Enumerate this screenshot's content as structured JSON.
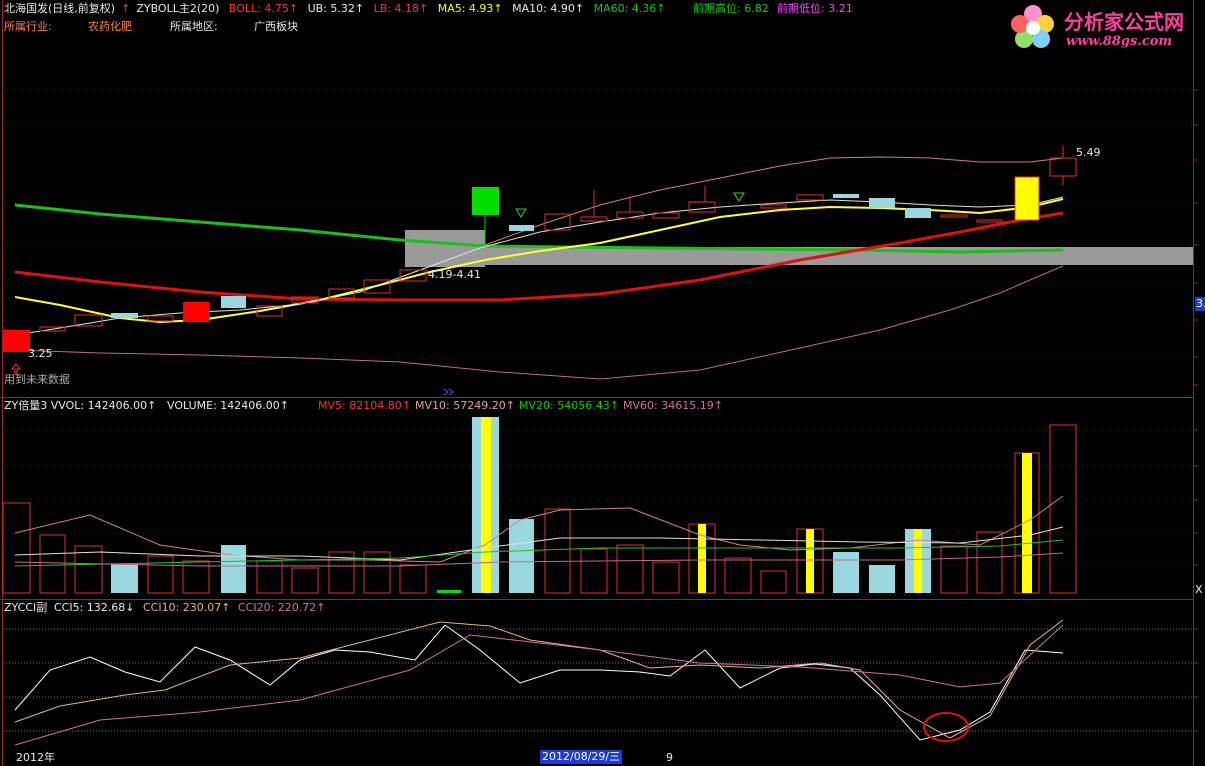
{
  "main_header": {
    "stock": "北海国发(日线,前复权)",
    "arrow": "↑",
    "indicator": "ZYBOLL主2(20)",
    "boll": "BOLL: 4.75↑",
    "ub": "UB: 5.32↑",
    "lb": "LB: 4.18↑",
    "ma5": "MA5: 4.93↑",
    "ma10": "MA10: 4.90↑",
    "ma60": "MA60: 4.36↑",
    "prev_high": "前期高位: 6.82",
    "prev_low": "前期低位: 3.21"
  },
  "info_row": {
    "industry_label": "所属行业:",
    "industry_value": "农药化肥",
    "region_label": "所属地区:",
    "region_value": "广西板块"
  },
  "main_annotations": {
    "high_label": "5.49",
    "low_label": "3.25",
    "range_label": "4.19-4.41",
    "future_note": "用到未来数据",
    "axis_marker": "3."
  },
  "volume_header": {
    "title": "ZY倍量3",
    "vvol": "VVOL: 142406.00↑",
    "volume": "VOLUME: 142406.00↑",
    "mv5": "MV5: 82104.80↑",
    "mv10": "MV10: 57249.20↑",
    "mv20": "MV20: 54056.43↑",
    "mv60": "MV60: 34615.19↑",
    "axis_marker": "X"
  },
  "cci_header": {
    "title": "ZYCCI副",
    "cci5": "CCI5: 132.68↓",
    "cci10": "CCI10: 230.07↑",
    "cci20": "CCI20: 220.72↑"
  },
  "footer": {
    "year": "2012年",
    "date": "2012/08/29/三",
    "month": "9"
  },
  "logo": {
    "title": "分析家公式网",
    "url": "www.88gs.com"
  },
  "colors": {
    "up": "#ff3030",
    "down": "#9ad8e0",
    "ma5": "#ffff00",
    "ma60": "#00d000",
    "boll_mid": "#ff2020",
    "band": "#d08080"
  }
}
